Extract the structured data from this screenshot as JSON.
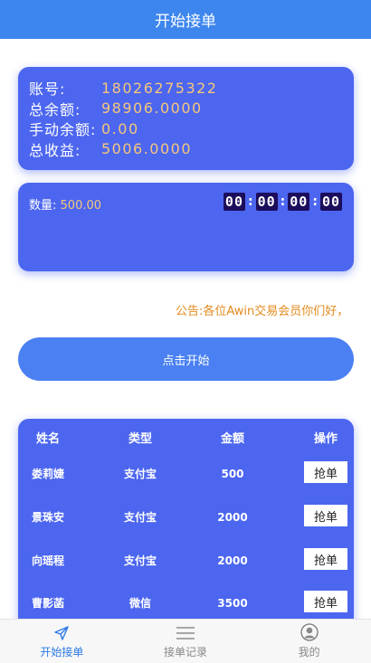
{
  "header": {
    "title": "开始接单"
  },
  "account": {
    "rows": [
      {
        "label": "账号:",
        "value": "18026275322"
      },
      {
        "label": "总余额:",
        "value": "98906.0000"
      },
      {
        "label": "手动余额:",
        "value": "0.00"
      },
      {
        "label": "总收益:",
        "value": "5006.0000"
      }
    ]
  },
  "amount_panel": {
    "label": "数量:",
    "value": "500.00",
    "timer": [
      "00",
      "00",
      "00",
      "00"
    ]
  },
  "notice": {
    "text": "公告:各位Awin交易会员你们好，"
  },
  "start_button": {
    "label": "点击开始"
  },
  "orders": {
    "headers": [
      "姓名",
      "类型",
      "金额",
      "操作"
    ],
    "rows": [
      {
        "name": "娄莉婕",
        "type": "支付宝",
        "amount": "500",
        "action": "抢单"
      },
      {
        "name": "景珠安",
        "type": "支付宝",
        "amount": "2000",
        "action": "抢单"
      },
      {
        "name": "向瑶程",
        "type": "支付宝",
        "amount": "2000",
        "action": "抢单"
      },
      {
        "name": "曹影菡",
        "type": "微信",
        "amount": "3500",
        "action": "抢单"
      }
    ]
  },
  "tabbar": {
    "items": [
      {
        "label": "开始接单",
        "icon": "send-icon",
        "active": true
      },
      {
        "label": "接单记录",
        "icon": "list-icon",
        "active": false
      },
      {
        "label": "我的",
        "icon": "user-icon",
        "active": false
      }
    ]
  },
  "colors": {
    "header": "#3d86ee",
    "card": "#4c66ef",
    "accent_value": "#f6c77a",
    "notice": "#e38b1e",
    "tab_active": "#2d7be6"
  }
}
